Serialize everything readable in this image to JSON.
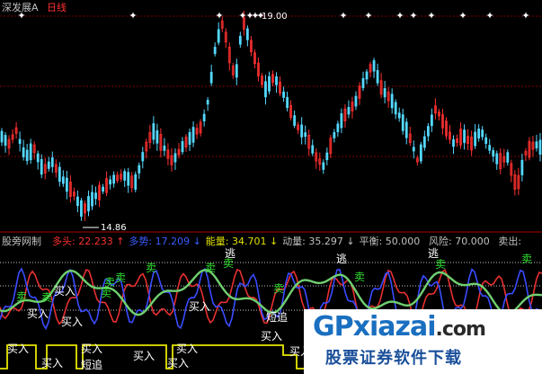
{
  "header": {
    "title": "深发展A",
    "period": "日线",
    "high_label": "19.00",
    "low_label": "14.86"
  },
  "indicator": {
    "name": "股旁网制",
    "items": [
      {
        "label": "多头:",
        "value": "22.233",
        "arrow": "↑",
        "color": "#ff3030"
      },
      {
        "label": "多势:",
        "value": "17.209",
        "arrow": "↓",
        "color": "#3a5cff"
      },
      {
        "label": "能量:",
        "value": "34.701",
        "arrow": "↓",
        "color": "#e0e000"
      },
      {
        "label": "动量:",
        "value": "35.297",
        "arrow": "↓",
        "color": "#c0c0c0"
      },
      {
        "label": "平衡:",
        "value": "50.000",
        "arrow": "",
        "color": "#c0c0c0"
      },
      {
        "label": "风险:",
        "value": "70.000",
        "arrow": "",
        "color": "#c0c0c0"
      },
      {
        "label": "卖出:",
        "value": "",
        "arrow": "",
        "color": "#c0c0c0"
      }
    ]
  },
  "signals": {
    "buy": "买入",
    "sell": "卖",
    "escape": "逃",
    "short": "短追"
  },
  "watermark": {
    "brand": "GPxiazai",
    "tld": ".com",
    "subtitle": "股票证券软件下载"
  },
  "colors": {
    "up": "#ff3030",
    "down": "#54d8ff",
    "grid": "#8a0000",
    "energy": "#e8e800",
    "momentum": "#70d070",
    "bull": "#e83030",
    "bear": "#3a4cff",
    "signal_text": "#ffffff",
    "sell_text": "#30e030"
  }
}
